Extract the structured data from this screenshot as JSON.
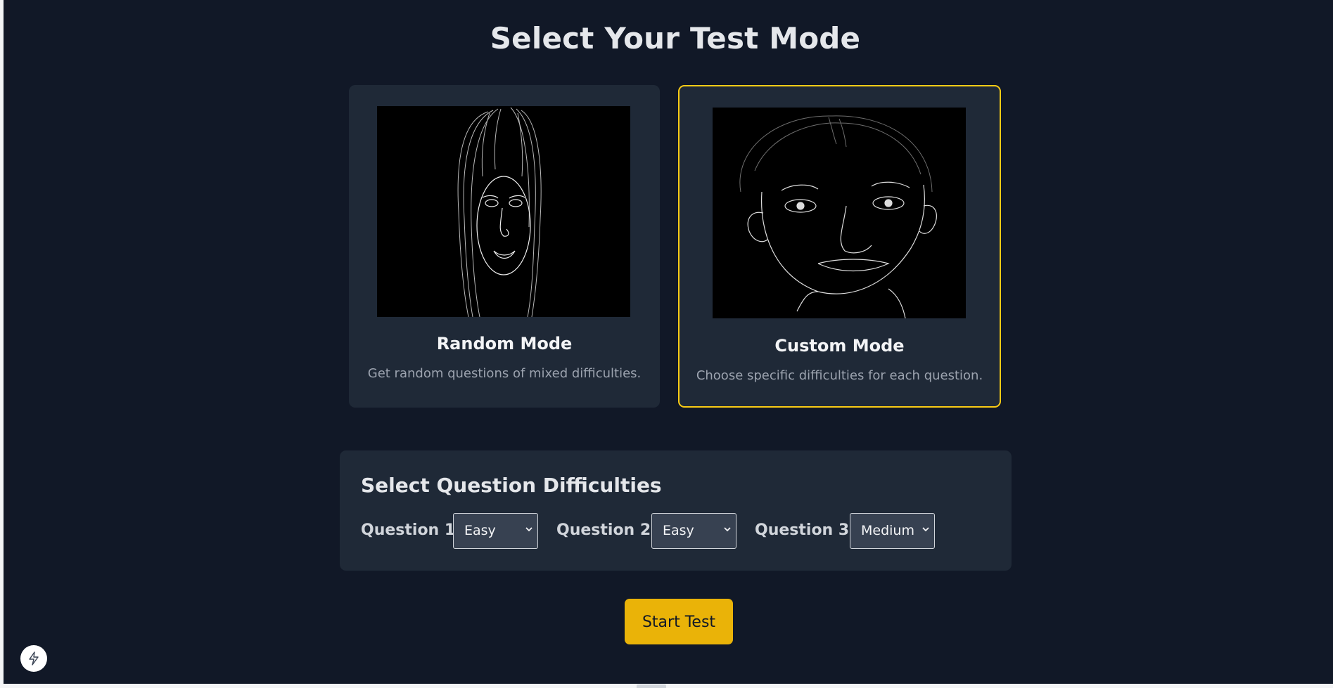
{
  "page": {
    "title": "Select Your Test Mode"
  },
  "modes": [
    {
      "name": "Random Mode",
      "description": "Get random questions of mixed difficulties.",
      "image": "face-sketch-long-hair",
      "selected": false
    },
    {
      "name": "Custom Mode",
      "description": "Choose specific difficulties for each question.",
      "image": "face-sketch-short-hair",
      "selected": true
    }
  ],
  "difficulty_panel": {
    "title": "Select Question Difficulties",
    "questions": [
      {
        "label": "Question 1",
        "value": "Easy"
      },
      {
        "label": "Question 2",
        "value": "Easy"
      },
      {
        "label": "Question 3",
        "value": "Medium"
      }
    ]
  },
  "start_button": {
    "label": "Start Test",
    "color": "#eab308"
  },
  "floating_button": {
    "icon": "lightning-bolt-icon"
  },
  "colors": {
    "background": "#111827",
    "card": "#1f2937",
    "selected_border": "#facc15"
  }
}
